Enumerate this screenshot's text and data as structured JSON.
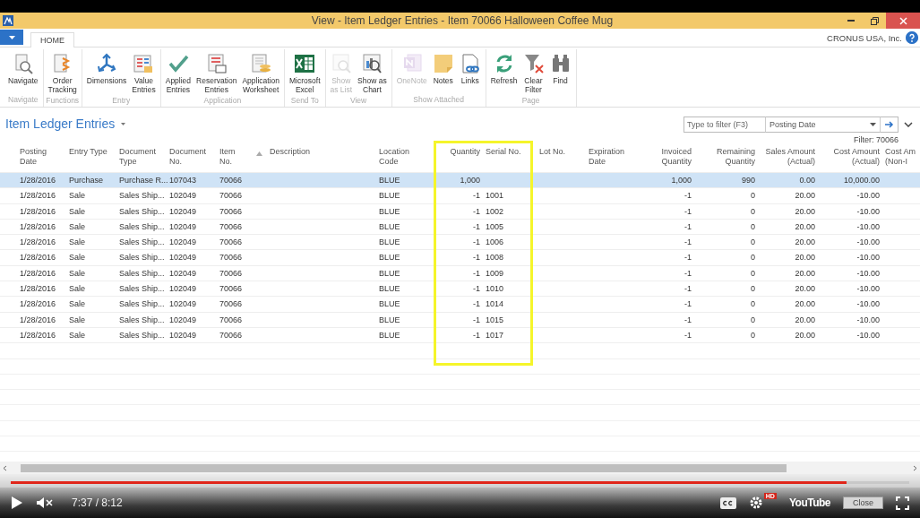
{
  "window": {
    "title": "View - Item Ledger Entries - Item 70066 Halloween Coffee Mug"
  },
  "ribbon": {
    "tabs": [
      {
        "label": "HOME",
        "selected": true
      }
    ],
    "company": "CRONUS USA, Inc.",
    "groups": [
      {
        "label": "Navigate",
        "buttons": [
          {
            "label": "Navigate",
            "disabled": false
          }
        ]
      },
      {
        "label": "Functions",
        "buttons": [
          {
            "label": "Order\nTracking",
            "disabled": false
          }
        ]
      },
      {
        "label": "Entry",
        "buttons": [
          {
            "label": "Dimensions",
            "disabled": false
          },
          {
            "label": "Value\nEntries",
            "disabled": false
          }
        ]
      },
      {
        "label": "Application",
        "buttons": [
          {
            "label": "Applied\nEntries",
            "disabled": false
          },
          {
            "label": "Reservation\nEntries",
            "disabled": false
          },
          {
            "label": "Application\nWorksheet",
            "disabled": false
          }
        ]
      },
      {
        "label": "Send To",
        "buttons": [
          {
            "label": "Microsoft\nExcel",
            "disabled": false
          }
        ]
      },
      {
        "label": "View",
        "buttons": [
          {
            "label": "Show\nas List",
            "disabled": true
          },
          {
            "label": "Show as\nChart",
            "disabled": false
          }
        ]
      },
      {
        "label": "Show Attached",
        "buttons": [
          {
            "label": "OneNote",
            "disabled": true
          },
          {
            "label": "Notes",
            "disabled": false
          },
          {
            "label": "Links",
            "disabled": false
          }
        ]
      },
      {
        "label": "Page",
        "buttons": [
          {
            "label": "Refresh",
            "disabled": false
          },
          {
            "label": "Clear\nFilter",
            "disabled": false
          },
          {
            "label": "Find",
            "disabled": false
          }
        ]
      }
    ]
  },
  "page": {
    "title": "Item Ledger Entries",
    "filter": {
      "placeholder": "Type to filter (F3)",
      "field": "Posting Date"
    },
    "filter_status": "Filter: 70066"
  },
  "table": {
    "columns": [
      {
        "label": "Posting\nDate",
        "numeric": false,
        "sorted": false
      },
      {
        "label": "Entry Type",
        "numeric": false,
        "sorted": false
      },
      {
        "label": "Document\nType",
        "numeric": false,
        "sorted": false
      },
      {
        "label": "Document\nNo.",
        "numeric": false,
        "sorted": false
      },
      {
        "label": "Item\nNo.",
        "numeric": false,
        "sorted": true
      },
      {
        "label": "Description",
        "numeric": false,
        "sorted": false
      },
      {
        "label": "Location\nCode",
        "numeric": false,
        "sorted": false
      },
      {
        "label": "Quantity",
        "numeric": true,
        "sorted": false
      },
      {
        "label": "Serial No.",
        "numeric": false,
        "sorted": false
      },
      {
        "label": "Lot No.",
        "numeric": false,
        "sorted": false
      },
      {
        "label": "Expiration\nDate",
        "numeric": false,
        "sorted": false
      },
      {
        "label": "Invoiced\nQuantity",
        "numeric": true,
        "sorted": false
      },
      {
        "label": "Remaining\nQuantity",
        "numeric": true,
        "sorted": false
      },
      {
        "label": "Sales Amount\n(Actual)",
        "numeric": true,
        "sorted": false
      },
      {
        "label": "Cost Amount\n(Actual)",
        "numeric": true,
        "sorted": false
      },
      {
        "label": "Cost Am\n(Non-I",
        "numeric": false,
        "sorted": false
      }
    ],
    "rows": [
      {
        "selected": true,
        "cells": [
          "1/28/2016",
          "Purchase",
          "Purchase R...",
          "107043",
          "70066",
          null,
          "BLUE",
          "1,000",
          null,
          null,
          null,
          "1,000",
          "990",
          "0.00",
          "10,000.00",
          null
        ]
      },
      {
        "selected": false,
        "cells": [
          "1/28/2016",
          "Sale",
          "Sales Ship...",
          "102049",
          "70066",
          null,
          "BLUE",
          "-1",
          "1001",
          null,
          null,
          "-1",
          "0",
          "20.00",
          "-10.00",
          null
        ]
      },
      {
        "selected": false,
        "cells": [
          "1/28/2016",
          "Sale",
          "Sales Ship...",
          "102049",
          "70066",
          null,
          "BLUE",
          "-1",
          "1002",
          null,
          null,
          "-1",
          "0",
          "20.00",
          "-10.00",
          null
        ]
      },
      {
        "selected": false,
        "cells": [
          "1/28/2016",
          "Sale",
          "Sales Ship...",
          "102049",
          "70066",
          null,
          "BLUE",
          "-1",
          "1005",
          null,
          null,
          "-1",
          "0",
          "20.00",
          "-10.00",
          null
        ]
      },
      {
        "selected": false,
        "cells": [
          "1/28/2016",
          "Sale",
          "Sales Ship...",
          "102049",
          "70066",
          null,
          "BLUE",
          "-1",
          "1006",
          null,
          null,
          "-1",
          "0",
          "20.00",
          "-10.00",
          null
        ]
      },
      {
        "selected": false,
        "cells": [
          "1/28/2016",
          "Sale",
          "Sales Ship...",
          "102049",
          "70066",
          null,
          "BLUE",
          "-1",
          "1008",
          null,
          null,
          "-1",
          "0",
          "20.00",
          "-10.00",
          null
        ]
      },
      {
        "selected": false,
        "cells": [
          "1/28/2016",
          "Sale",
          "Sales Ship...",
          "102049",
          "70066",
          null,
          "BLUE",
          "-1",
          "1009",
          null,
          null,
          "-1",
          "0",
          "20.00",
          "-10.00",
          null
        ]
      },
      {
        "selected": false,
        "cells": [
          "1/28/2016",
          "Sale",
          "Sales Ship...",
          "102049",
          "70066",
          null,
          "BLUE",
          "-1",
          "1010",
          null,
          null,
          "-1",
          "0",
          "20.00",
          "-10.00",
          null
        ]
      },
      {
        "selected": false,
        "cells": [
          "1/28/2016",
          "Sale",
          "Sales Ship...",
          "102049",
          "70066",
          null,
          "BLUE",
          "-1",
          "1014",
          null,
          null,
          "-1",
          "0",
          "20.00",
          "-10.00",
          null
        ]
      },
      {
        "selected": false,
        "cells": [
          "1/28/2016",
          "Sale",
          "Sales Ship...",
          "102049",
          "70066",
          null,
          "BLUE",
          "-1",
          "1015",
          null,
          null,
          "-1",
          "0",
          "20.00",
          "-10.00",
          null
        ]
      },
      {
        "selected": false,
        "cells": [
          "1/28/2016",
          "Sale",
          "Sales Ship...",
          "102049",
          "70066",
          null,
          "BLUE",
          "-1",
          "1017",
          null,
          null,
          "-1",
          "0",
          "20.00",
          "-10.00",
          null
        ]
      }
    ]
  },
  "player": {
    "level": 0.93,
    "time": "7:37 / 8:12",
    "close": "Close",
    "logo": "YouTube",
    "quality": "HD"
  }
}
